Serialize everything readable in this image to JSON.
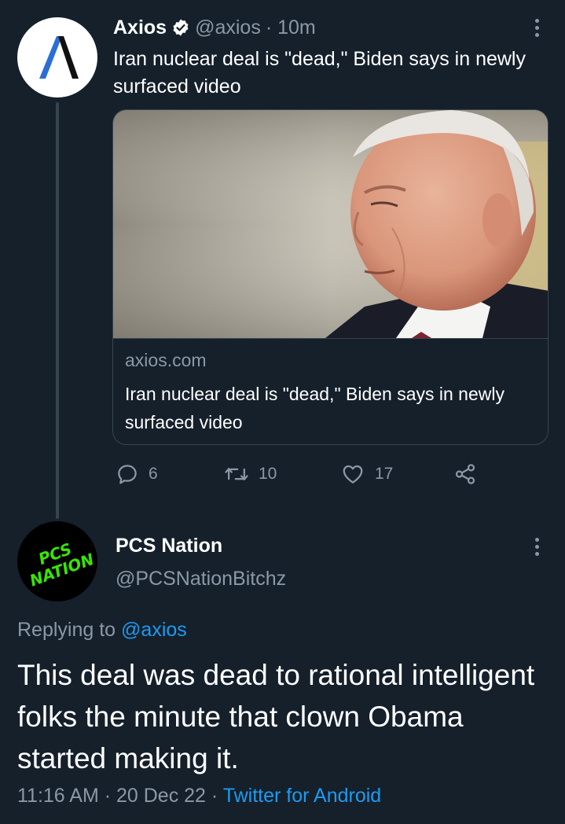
{
  "tweet": {
    "author_name": "Axios",
    "author_handle": "@axios",
    "time_ago": "· 10m",
    "text": "Iran nuclear deal is \"dead,\" Biden says in newly surfaced video",
    "card": {
      "domain": "axios.com",
      "title": "Iran nuclear deal is \"dead,\" Biden says in newly surfaced video"
    },
    "actions": {
      "replies": "6",
      "retweets": "10",
      "likes": "17"
    }
  },
  "reply": {
    "author_name": "PCS Nation",
    "author_handle": "@PCSNationBitchz",
    "avatar_text": [
      "PCS",
      "NATION"
    ],
    "replying_prefix": "Replying to",
    "replying_to": "@axios",
    "text": "This deal was dead to rational intelligent folks the minute that clown Obama started making it.",
    "timestamp": "11:16 AM · 20 Dec 22 ·",
    "source": "Twitter for Android"
  },
  "colors": {
    "background": "#15202b",
    "muted_text": "#8b98a5",
    "link": "#1d9bf0",
    "border": "#38444d",
    "verified": "#ffffff",
    "axios_logo_blue": "#2a6fd6",
    "pcs_logo_green": "#39e600"
  },
  "icons": [
    "axios-logo-icon",
    "verified-badge-icon",
    "more-icon",
    "reply-icon",
    "retweet-icon",
    "like-icon",
    "share-icon"
  ]
}
